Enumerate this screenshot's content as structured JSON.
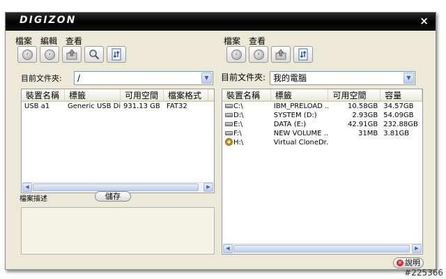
{
  "window": {
    "logo": "DIGIZON",
    "close": "×"
  },
  "left": {
    "menu": [
      "檔案",
      "編輯",
      "查看"
    ],
    "toolbar": [
      "back-icon",
      "forward-icon",
      "folder-up-icon",
      "search-icon",
      "refresh-icon"
    ],
    "path_label": "目前文件夾:",
    "path_value": "/",
    "columns": [
      "裝置名稱",
      "標籤",
      "可用空間",
      "檔案格式"
    ],
    "rows": [
      {
        "device": "USB a1",
        "label": "Generic USB Disk",
        "free": "931.13 GB",
        "format": "FAT32"
      }
    ],
    "desc_label": "檔案描述",
    "save_label": "儲存"
  },
  "right": {
    "menu": [
      "檔案",
      "查看"
    ],
    "toolbar": [
      "back-icon",
      "forward-icon",
      "folder-up-icon",
      "refresh-icon"
    ],
    "path_label": "目前文件夾:",
    "path_value": "我的電腦",
    "columns": [
      "裝置名稱",
      "標籤",
      "可用空間",
      "容量"
    ],
    "rows": [
      {
        "device": "C:\\",
        "label": "IBM_PRELOAD ...",
        "free": "10.58GB",
        "capacity": "34.57GB",
        "icon": "drive-icon"
      },
      {
        "device": "D:\\",
        "label": "SYSTEM (D:)",
        "free": "2.93GB",
        "capacity": "54.09GB",
        "icon": "drive-icon"
      },
      {
        "device": "E:\\",
        "label": "DATA (E:)",
        "free": "42.91GB",
        "capacity": "232.88GB",
        "icon": "drive-icon"
      },
      {
        "device": "F:\\",
        "label": "NEW VOLUME ...",
        "free": "31MB",
        "capacity": "3.81GB",
        "icon": "drive-icon"
      },
      {
        "device": "H:\\",
        "label": "Virtual CloneDr...",
        "free": "",
        "capacity": "",
        "icon": "cd-drive-icon"
      }
    ],
    "help_label": "說明"
  },
  "watermark": "#225366"
}
